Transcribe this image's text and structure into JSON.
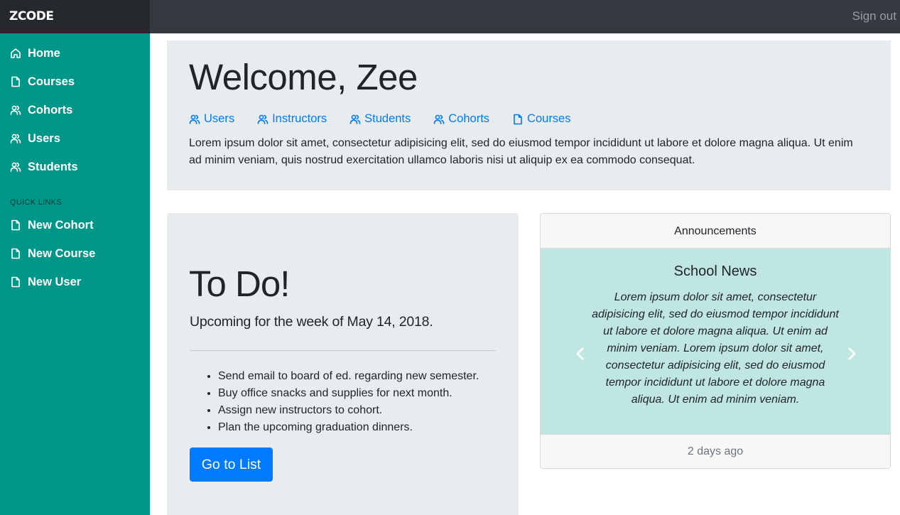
{
  "brand": "ZCODE",
  "header": {
    "signout": "Sign out"
  },
  "sidebar": {
    "items": [
      {
        "label": "Home",
        "icon": "home-icon"
      },
      {
        "label": "Courses",
        "icon": "file-icon"
      },
      {
        "label": "Cohorts",
        "icon": "users-icon"
      },
      {
        "label": "Users",
        "icon": "users-icon"
      },
      {
        "label": "Students",
        "icon": "users-icon"
      }
    ],
    "quick_links_heading": "QUICK LINKS",
    "quick_links": [
      {
        "label": "New Cohort",
        "icon": "file-icon"
      },
      {
        "label": "New Course",
        "icon": "file-icon"
      },
      {
        "label": "New User",
        "icon": "file-icon"
      }
    ]
  },
  "jumbotron": {
    "title": "Welcome, Zee",
    "links": [
      {
        "label": "Users",
        "icon": "users-icon"
      },
      {
        "label": "Instructors",
        "icon": "users-icon"
      },
      {
        "label": "Students",
        "icon": "users-icon"
      },
      {
        "label": "Cohorts",
        "icon": "users-icon"
      },
      {
        "label": "Courses",
        "icon": "file-icon"
      }
    ],
    "text": "Lorem ipsum dolor sit amet, consectetur adipisicing elit, sed do eiusmod tempor incididunt ut labore et dolore magna aliqua. Ut enim ad minim veniam, quis nostrud exercitation ullamco laboris nisi ut aliquip ex ea commodo consequat."
  },
  "todo": {
    "title": "To Do!",
    "subtitle": "Upcoming for the week of May 14, 2018.",
    "items": [
      "Send email to board of ed. regarding new semester.",
      "Buy office snacks and supplies for next month.",
      "Assign new instructors to cohort.",
      "Plan the upcoming graduation dinners."
    ],
    "button": "Go to List"
  },
  "announcements": {
    "header": "Announcements",
    "slide_title": "School News",
    "slide_text": "Lorem ipsum dolor sit amet, consectetur adipisicing elit, sed do eiusmod tempor incididunt ut labore et dolore magna aliqua. Ut enim ad minim veniam. Lorem ipsum dolor sit amet, consectetur adipisicing elit, sed do eiusmod tempor incididunt ut labore et dolore magna aliqua. Ut enim ad minim veniam.",
    "footer": "2 days ago"
  },
  "colors": {
    "sidebar": "#009688",
    "topbar": "#343a40",
    "brand_bg": "#25292d",
    "primary": "#007bff",
    "panel": "#e9ecef",
    "carousel": "#bfe6e1"
  }
}
